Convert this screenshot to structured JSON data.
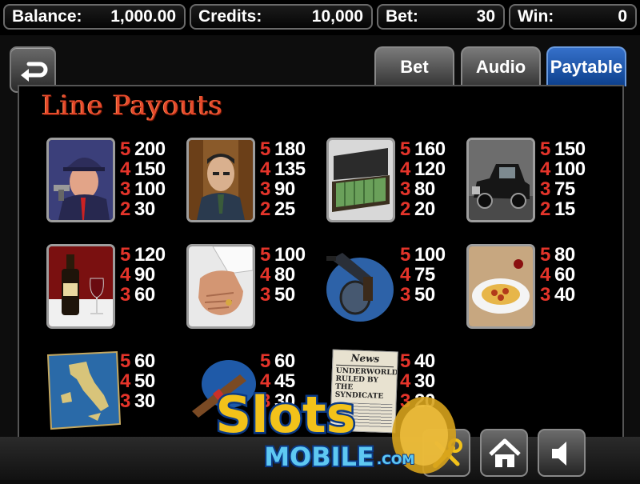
{
  "status_bar": {
    "balance": {
      "label": "Balance:",
      "value": "1,000.00"
    },
    "credits": {
      "label": "Credits:",
      "value": "10,000"
    },
    "bet": {
      "label": "Bet:",
      "value": "30"
    },
    "win": {
      "label": "Win:",
      "value": "0"
    }
  },
  "tabs": [
    {
      "label": "Bet",
      "active": false
    },
    {
      "label": "Audio",
      "active": false
    },
    {
      "label": "Paytable",
      "active": true
    }
  ],
  "panel_title": "Line Payouts",
  "symbols": [
    {
      "name": "gangster-with-gun",
      "payouts": [
        {
          "count": "5",
          "amount": "200"
        },
        {
          "count": "4",
          "amount": "150"
        },
        {
          "count": "3",
          "amount": "100"
        },
        {
          "count": "2",
          "amount": "30"
        }
      ]
    },
    {
      "name": "mob-boss",
      "payouts": [
        {
          "count": "5",
          "amount": "180"
        },
        {
          "count": "4",
          "amount": "135"
        },
        {
          "count": "3",
          "amount": "90"
        },
        {
          "count": "2",
          "amount": "25"
        }
      ]
    },
    {
      "name": "briefcase-of-cash",
      "payouts": [
        {
          "count": "5",
          "amount": "160"
        },
        {
          "count": "4",
          "amount": "120"
        },
        {
          "count": "3",
          "amount": "80"
        },
        {
          "count": "2",
          "amount": "20"
        }
      ]
    },
    {
      "name": "vintage-car",
      "payouts": [
        {
          "count": "5",
          "amount": "150"
        },
        {
          "count": "4",
          "amount": "100"
        },
        {
          "count": "3",
          "amount": "75"
        },
        {
          "count": "2",
          "amount": "15"
        }
      ]
    },
    {
      "name": "wine-bottle-and-glass",
      "payouts": [
        {
          "count": "5",
          "amount": "120"
        },
        {
          "count": "4",
          "amount": "90"
        },
        {
          "count": "3",
          "amount": "60"
        }
      ]
    },
    {
      "name": "hand-with-ring",
      "payouts": [
        {
          "count": "5",
          "amount": "100"
        },
        {
          "count": "4",
          "amount": "80"
        },
        {
          "count": "3",
          "amount": "50"
        }
      ]
    },
    {
      "name": "tommy-gun",
      "payouts": [
        {
          "count": "5",
          "amount": "100"
        },
        {
          "count": "4",
          "amount": "75"
        },
        {
          "count": "3",
          "amount": "50"
        }
      ]
    },
    {
      "name": "spaghetti-plate",
      "payouts": [
        {
          "count": "5",
          "amount": "80"
        },
        {
          "count": "4",
          "amount": "60"
        },
        {
          "count": "3",
          "amount": "40"
        }
      ]
    },
    {
      "name": "map-of-italy",
      "payouts": [
        {
          "count": "5",
          "amount": "60"
        },
        {
          "count": "4",
          "amount": "50"
        },
        {
          "count": "3",
          "amount": "30"
        }
      ]
    },
    {
      "name": "cigar",
      "payouts": [
        {
          "count": "5",
          "amount": "60"
        },
        {
          "count": "4",
          "amount": "45"
        },
        {
          "count": "3",
          "amount": "30"
        }
      ]
    },
    {
      "name": "newspaper",
      "payouts": [
        {
          "count": "5",
          "amount": "40"
        },
        {
          "count": "4",
          "amount": "30"
        },
        {
          "count": "3",
          "amount": "20"
        }
      ]
    }
  ],
  "newspaper_text": {
    "masthead": "News",
    "headline": "UNDERWORLD RULED BY THE SYNDICATE"
  },
  "watermark": {
    "line1": "Slots",
    "line2": "MOBILE",
    "suffix": ".COM"
  },
  "controls": {
    "back_icon": "return-arrow-icon",
    "settings_icon": "tools-icon",
    "home_icon": "home-icon",
    "sound_icon": "speaker-icon"
  },
  "colors": {
    "payout_count": "#e4342a",
    "title": "#e5492b",
    "active_tab": "#1a4fa6"
  }
}
